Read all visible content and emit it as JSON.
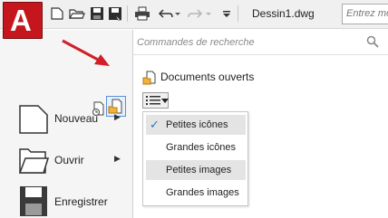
{
  "app": {
    "logo_letter": "A",
    "brand_color": "#c4161c"
  },
  "title_bar": {
    "document_title": "Dessin1.dwg",
    "search_placeholder": "Entrez mots"
  },
  "search": {
    "placeholder": "Commandes de recherche"
  },
  "open_documents": {
    "header": "Documents ouverts"
  },
  "left_menu": [
    {
      "label": "Nouveau",
      "has_submenu": true,
      "icon": "new-document-icon"
    },
    {
      "label": "Ouvrir",
      "has_submenu": true,
      "icon": "open-folder-icon"
    },
    {
      "label": "Enregistrer",
      "has_submenu": false,
      "icon": "save-icon"
    }
  ],
  "view_menu": {
    "items": [
      {
        "label": "Petites icônes",
        "checked": true,
        "highlighted": true
      },
      {
        "label": "Grandes icônes",
        "checked": false,
        "highlighted": false
      },
      {
        "label": "Petites images",
        "checked": false,
        "highlighted": true
      },
      {
        "label": "Grandes images",
        "checked": false,
        "highlighted": false
      }
    ],
    "check_glyph": "✓"
  },
  "submenu_arrow": "▶",
  "annotation": {
    "arrow_color": "#d0202a"
  }
}
